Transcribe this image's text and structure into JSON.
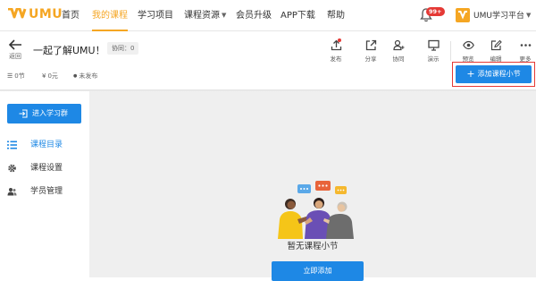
{
  "brand": {
    "name": "UMU",
    "accent": "#f5a623",
    "primary": "#1e88e5",
    "alert": "#e53935"
  },
  "topnav": {
    "items": [
      {
        "label": "首页"
      },
      {
        "label": "我的课程",
        "active": true
      },
      {
        "label": "学习项目"
      },
      {
        "label": "课程资源",
        "dropdown": true
      },
      {
        "label": "会员升级"
      },
      {
        "label": "APP下载"
      },
      {
        "label": "帮助"
      }
    ],
    "notifications_badge": "99+",
    "org_name": "UMU学习平台",
    "icons": [
      "bell-icon",
      "chevron-down-icon"
    ]
  },
  "course": {
    "back_label": "返回",
    "title": "一起了解UMU！",
    "collab_tag": "协同：0",
    "toolbar": [
      {
        "icon": "publish-icon",
        "label": "发布",
        "dot": true
      },
      {
        "icon": "share-icon",
        "label": "分享"
      },
      {
        "icon": "collaborate-icon",
        "label": "协同"
      },
      {
        "icon": "present-icon",
        "label": "演示"
      },
      {
        "icon": "preview-icon",
        "label": "预览"
      },
      {
        "icon": "edit-icon",
        "label": "编辑"
      },
      {
        "icon": "more-icon",
        "label": "更多"
      }
    ],
    "stats": {
      "sections": "0节",
      "price": "0元",
      "status": "未发布"
    },
    "add_section_label": "添加课程小节"
  },
  "sidebar": {
    "join_group_label": "进入学习群",
    "items": [
      {
        "label": "课程目录",
        "icon": "list-icon",
        "active": true
      },
      {
        "label": "课程设置",
        "icon": "gear-icon"
      },
      {
        "label": "学员管理",
        "icon": "users-icon"
      }
    ]
  },
  "main": {
    "empty_text": "暂无课程小节",
    "add_now_label": "立即添加"
  }
}
